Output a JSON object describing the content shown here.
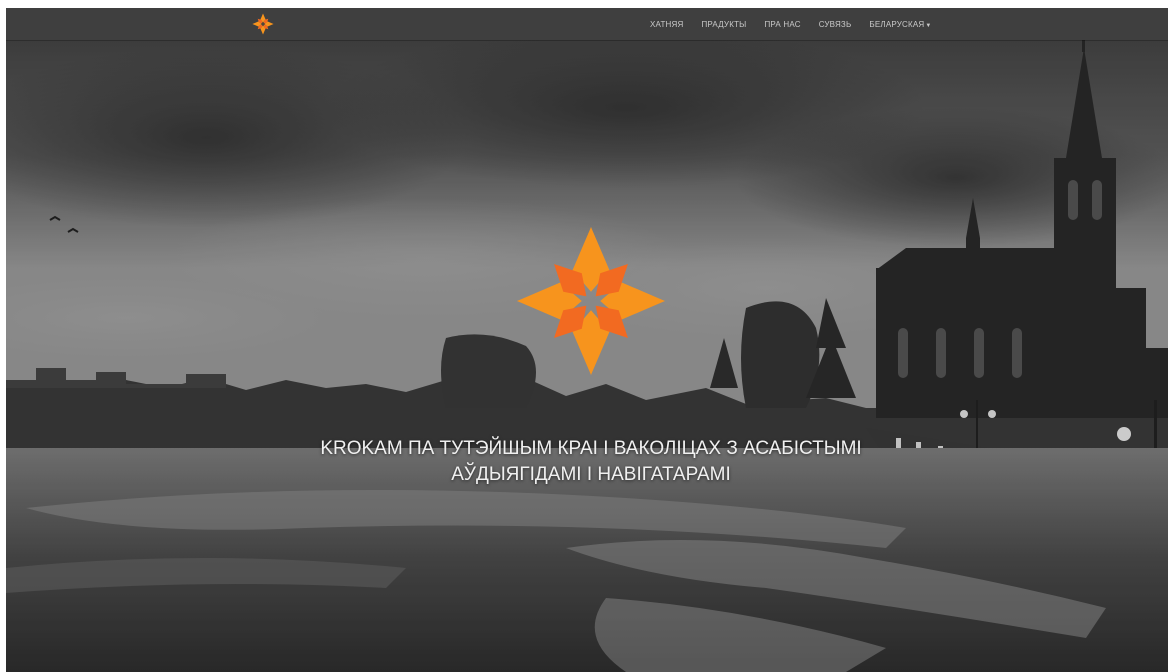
{
  "nav": {
    "logo": {
      "icon": "star-ornament-icon",
      "color": "#f7941d"
    },
    "items": [
      {
        "label": "ХАТНЯЯ"
      },
      {
        "label": "ПРАДУКТЫ"
      },
      {
        "label": "ПРА НАС"
      },
      {
        "label": "СУВЯЗЬ"
      },
      {
        "label": "БЕЛАРУСКАЯ",
        "has_dropdown": true,
        "caret_icon": "caret-down-icon"
      }
    ]
  },
  "hero": {
    "emblem": {
      "icon": "star-ornament-icon",
      "color": "#f7941d",
      "inner_color": "#f26a21"
    },
    "tagline_line1": "KROKAM ПА ТУТЭЙШЫМ КРАІ І ВАКОЛІЦАХ З АСАБІСТЫМІ",
    "tagline_line2": "АЎДЫЯГІДАМІ І НАВІГАТАРАМІ",
    "background": "grayscale-landscape-river-church"
  },
  "colors": {
    "navbar_bg": "#3f3f3f",
    "nav_text": "#c9c9c9",
    "accent_orange": "#f7941d",
    "accent_dark_orange": "#f26a21"
  }
}
